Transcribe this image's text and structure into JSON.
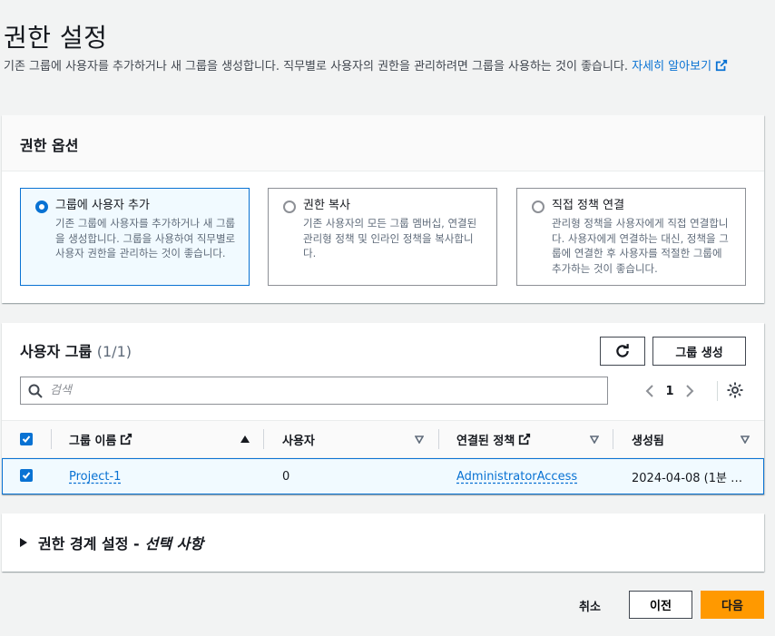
{
  "page": {
    "title": "권한 설정",
    "description": "기존 그룹에 사용자를 추가하거나 새 그룹을 생성합니다. 직무별로 사용자의 권한을 관리하려면 그룹을 사용하는 것이 좋습니다. ",
    "learn_more": "자세히 알아보기"
  },
  "permission_options": {
    "header": "권한 옵션",
    "options": [
      {
        "title": "그룹에 사용자 추가",
        "description": "기존 그룹에 사용자를 추가하거나 새 그룹을 생성합니다. 그룹을 사용하여 직무별로 사용자 권한을 관리하는 것이 좋습니다.",
        "selected": true
      },
      {
        "title": "권한 복사",
        "description": "기존 사용자의 모든 그룹 멤버십, 연결된 관리형 정책 및 인라인 정책을 복사합니다.",
        "selected": false
      },
      {
        "title": "직접 정책 연결",
        "description": "관리형 정책을 사용자에게 직접 연결합니다. 사용자에게 연결하는 대신, 정책을 그룹에 연결한 후 사용자를 적절한 그룹에 추가하는 것이 좋습니다.",
        "selected": false
      }
    ]
  },
  "user_groups": {
    "title": "사용자 그룹",
    "count": "(1/1)",
    "create_group_label": "그룹 생성",
    "search_placeholder": "검색",
    "current_page": "1",
    "columns": {
      "group_name": "그룹 이름",
      "users": "사용자",
      "attached_policies": "연결된 정책",
      "created": "생성됨"
    },
    "rows": [
      {
        "group_name": "Project-1",
        "users": "0",
        "attached_policies": "AdministratorAccess",
        "created": "2024-04-08 (1분 …",
        "selected": true
      }
    ]
  },
  "boundary": {
    "label": "권한 경계 설정 -",
    "optional": "선택 사항"
  },
  "footer": {
    "cancel": "취소",
    "previous": "이전",
    "next": "다음"
  },
  "colors": {
    "accent": "#0972d3",
    "primary_button": "#ff9900",
    "background": "#f2f3f3"
  }
}
